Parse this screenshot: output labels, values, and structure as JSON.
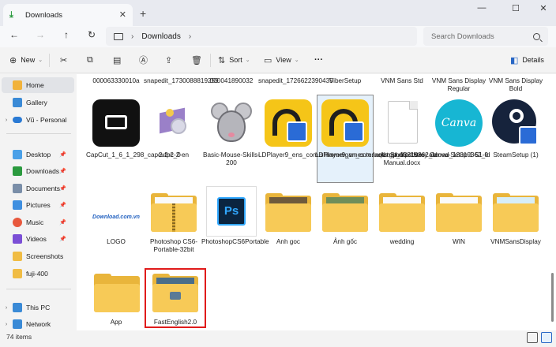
{
  "window": {
    "tab_title": "Downloads",
    "minimize": "—",
    "maximize": "☐",
    "close": "✕"
  },
  "address": {
    "breadcrumb": [
      "Downloads"
    ],
    "search_placeholder": "Search Downloads"
  },
  "commands": {
    "new_label": "New",
    "sort_label": "Sort",
    "view_label": "View",
    "more_label": "···",
    "details_label": "Details"
  },
  "nav": {
    "items": [
      {
        "label": "Home"
      },
      {
        "label": "Gallery"
      },
      {
        "label": "Vũ - Personal"
      },
      {
        "label": "Desktop"
      },
      {
        "label": "Downloads"
      },
      {
        "label": "Documents"
      },
      {
        "label": "Pictures"
      },
      {
        "label": "Music"
      },
      {
        "label": "Videos"
      },
      {
        "label": "Screenshots"
      },
      {
        "label": "fuji-400"
      },
      {
        "label": "This PC"
      },
      {
        "label": "Network"
      }
    ]
  },
  "files": {
    "row0": [
      {
        "name": "000063330010a"
      },
      {
        "name": "snapedit_1730088819259"
      },
      {
        "name": "000041890032"
      },
      {
        "name": "snapedit_1726622390435"
      },
      {
        "name": "ViberSetup"
      },
      {
        "name": "VNM Sans Std"
      },
      {
        "name": "VNM Sans Display Regular"
      },
      {
        "name": "VNM Sans Display Bold"
      }
    ],
    "row1": [
      {
        "name": "CapCut_1_6_1_298_capcutpc_0"
      },
      {
        "name": "2-2-2-2-en"
      },
      {
        "name": "Basic-Mouse-Skills-200"
      },
      {
        "name": "LDPlayer9_ens_com.shimmergames.tenants.gp_13319362_ld"
      },
      {
        "name": "LDPlayer9_vn_com.lxqd.myhotpotstroy.abroad_13319362_ld"
      },
      {
        "name": "Art Studio User Manual.docx"
      },
      {
        "name": "Canva-Setup-1-51-0"
      },
      {
        "name": "SteamSetup (1)"
      }
    ],
    "row2": [
      {
        "name": "LOGO"
      },
      {
        "name": "Photoshop CS6-Portable-32bit"
      },
      {
        "name": "PhotoshopCS6Portable"
      },
      {
        "name": "Anh goc"
      },
      {
        "name": "Ảnh gốc"
      },
      {
        "name": "wedding"
      },
      {
        "name": "WIN"
      },
      {
        "name": "VNMSansDisplay"
      }
    ],
    "row3": [
      {
        "name": "App"
      },
      {
        "name": "FastEnglish2.0"
      }
    ],
    "thumb_text": {
      "canva": "Canva",
      "logo": "Download.com.vn",
      "ps": "Ps"
    }
  },
  "status": {
    "item_count": "74 items"
  }
}
